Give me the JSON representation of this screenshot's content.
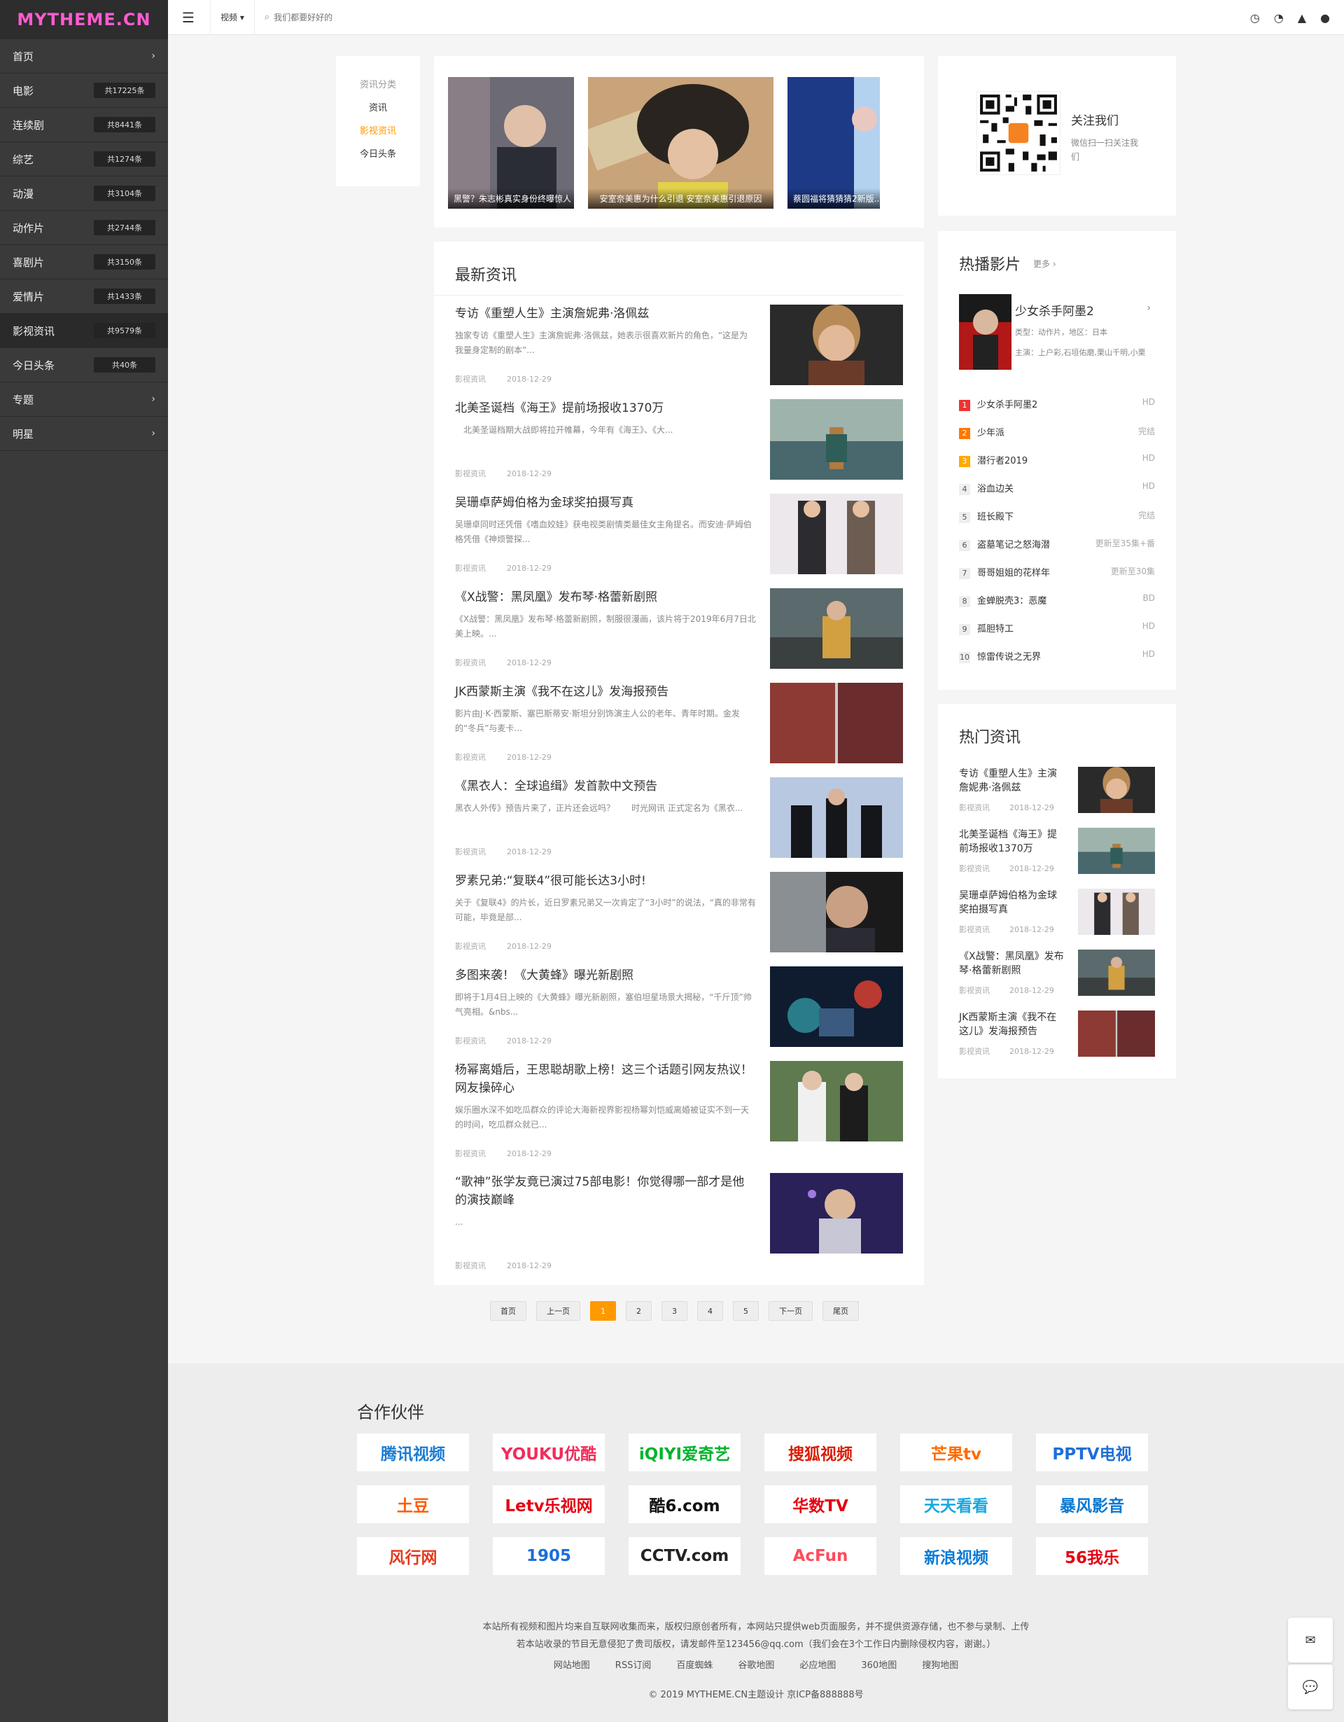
{
  "logo": "MYTHEME.CN",
  "nav": [
    {
      "label": "首页",
      "badge": "",
      "arrow": "›"
    },
    {
      "label": "电影",
      "badge": "共17225条",
      "arrow": ""
    },
    {
      "label": "连续剧",
      "badge": "共8441条",
      "arrow": ""
    },
    {
      "label": "综艺",
      "badge": "共1274条",
      "arrow": ""
    },
    {
      "label": "动漫",
      "badge": "共3104条",
      "arrow": ""
    },
    {
      "label": "动作片",
      "badge": "共2744条",
      "arrow": ""
    },
    {
      "label": "喜剧片",
      "badge": "共3150条",
      "arrow": ""
    },
    {
      "label": "爱情片",
      "badge": "共1433条",
      "arrow": ""
    },
    {
      "label": "影视资讯",
      "badge": "共9579条",
      "arrow": ""
    },
    {
      "label": "今日头条",
      "badge": "共40条",
      "arrow": ""
    },
    {
      "label": "专题",
      "badge": "",
      "arrow": "›"
    },
    {
      "label": "明星",
      "badge": "",
      "arrow": "›"
    }
  ],
  "topbar": {
    "select": "视频 ▾",
    "search_placeholder": "我们都要好好的",
    "icons": [
      "clock-icon",
      "rss-icon",
      "android-icon",
      "user-icon"
    ]
  },
  "category": {
    "title": "资讯分类",
    "items": [
      "资讯",
      "影视资讯",
      "今日头条"
    ],
    "active": 1
  },
  "slides": [
    {
      "caption": "黑警？朱志彬真实身份终曝惊人"
    },
    {
      "caption": "安室奈美惠为什么引退 安室奈美惠引退原因"
    },
    {
      "caption": "蔡圆福将猜猜猜2新版..."
    }
  ],
  "news": {
    "title": "最新资讯",
    "items": [
      {
        "title": "专访《重塑人生》主演詹妮弗·洛佩兹",
        "desc": "独家专访《重塑人生》主演詹妮弗·洛佩兹，她表示很喜欢新片的角色，“这是为我量身定制的剧本”...",
        "cat": "影视资讯",
        "date": "2018-12-29"
      },
      {
        "title": "北美圣诞档《海王》提前场报收1370万",
        "desc": "　北美圣诞档期大战即将拉开帷幕，今年有《海王》、《大...",
        "cat": "影视资讯",
        "date": "2018-12-29"
      },
      {
        "title": "吴珊卓萨姆伯格为金球奖拍摄写真",
        "desc": "吴珊卓同时还凭借《嗜血姣娃》获电视类剧情类最佳女主角提名。而安迪·萨姆伯格凭借《神烦警探...",
        "cat": "影视资讯",
        "date": "2018-12-29"
      },
      {
        "title": "《X战警：黑凤凰》发布琴·格蕾新剧照",
        "desc": "《X战警：黑凤凰》发布琴·格蕾新剧照，制服很漫画，该片将于2019年6月7日北美上映。...",
        "cat": "影视资讯",
        "date": "2018-12-29"
      },
      {
        "title": "JK西蒙斯主演《我不在这儿》发海报预告",
        "desc": "影片由J·K·西蒙斯、塞巴斯蒂安·斯坦分别饰演主人公的老年、青年时期。金发的“冬兵”与麦卡...",
        "cat": "影视资讯",
        "date": "2018-12-29"
      },
      {
        "title": "《黑衣人：全球追缉》发首款中文预告",
        "desc": "黑衣人外传》预告片来了，正片还会远吗？　　时光网讯 正式定名为《黑衣...",
        "cat": "影视资讯",
        "date": "2018-12-29"
      },
      {
        "title": "罗素兄弟:“复联4”很可能长达3小时!",
        "desc": "关于《复联4》的片长，近日罗素兄弟又一次肯定了“3小时”的说法，“真的非常有可能，毕竟是部...",
        "cat": "影视资讯",
        "date": "2018-12-29"
      },
      {
        "title": "多图来袭！《大黄蜂》曝光新剧照",
        "desc": "即将于1月4日上映的《大黄蜂》曝光新剧照，塞伯坦星场景大揭秘，“千斤顶”帅气亮相。&nbs...",
        "cat": "影视资讯",
        "date": "2018-12-29"
      },
      {
        "title": "杨幂离婚后，王思聪胡歌上榜！这三个话题引网友热议！网友操碎心",
        "desc": "娱乐圈水深不如吃瓜群众的评论大海新视界影视杨幂刘恺威离婚被证实不到一天的时间，吃瓜群众就已...",
        "cat": "影视资讯",
        "date": "2018-12-29"
      },
      {
        "title": "“歌神”张学友竟已演过75部电影！你觉得哪一部才是他的演技巅峰",
        "desc": "...",
        "cat": "影视资讯",
        "date": "2018-12-29"
      }
    ]
  },
  "pager": [
    "首页",
    "上一页",
    "1",
    "2",
    "3",
    "4",
    "5",
    "下一页",
    "尾页"
  ],
  "follow": {
    "title": "关注我们",
    "desc": "微信扫一扫关注我们"
  },
  "hot": {
    "title": "热播影片",
    "more": "更多 ›",
    "featured": {
      "name": "少女杀手阿墨2",
      "type": "类型：动作片，地区：日本",
      "cast": "主演：上户彩,石垣佑磨,栗山千明,小栗"
    },
    "list": [
      {
        "rank": "1",
        "name": "少女杀手阿墨2",
        "status": "HD"
      },
      {
        "rank": "2",
        "name": "少年派",
        "status": "完结"
      },
      {
        "rank": "3",
        "name": "潜行者2019",
        "status": "HD"
      },
      {
        "rank": "4",
        "name": "浴血边关",
        "status": "HD"
      },
      {
        "rank": "5",
        "name": "班长殿下",
        "status": "完结"
      },
      {
        "rank": "6",
        "name": "盗墓笔记之怒海潜",
        "status": "更新至35集+番"
      },
      {
        "rank": "7",
        "name": "哥哥姐姐的花样年",
        "status": "更新至30集"
      },
      {
        "rank": "8",
        "name": "金蝉脱壳3：恶魔",
        "status": "BD"
      },
      {
        "rank": "9",
        "name": "孤胆特工",
        "status": "HD"
      },
      {
        "rank": "10",
        "name": "惊雷传说之无界",
        "status": "HD"
      }
    ]
  },
  "hotnews": {
    "title": "热门资讯",
    "items": [
      {
        "title": "专访《重塑人生》主演詹妮弗·洛佩兹",
        "cat": "影视资讯",
        "date": "2018-12-29"
      },
      {
        "title": "北美圣诞档《海王》提前场报收1370万",
        "cat": "影视资讯",
        "date": "2018-12-29"
      },
      {
        "title": "吴珊卓萨姆伯格为金球奖拍摄写真",
        "cat": "影视资讯",
        "date": "2018-12-29"
      },
      {
        "title": "《X战警：黑凤凰》发布琴·格蕾新剧照",
        "cat": "影视资讯",
        "date": "2018-12-29"
      },
      {
        "title": "JK西蒙斯主演《我不在这儿》发海报预告",
        "cat": "影视资讯",
        "date": "2018-12-29"
      }
    ]
  },
  "partners": {
    "title": "合作伙伴",
    "logos": [
      {
        "name": "腾讯视频",
        "color": "#1a7cd3"
      },
      {
        "name": "YOUKU优酷",
        "color": "#f02d5b"
      },
      {
        "name": "iQIYI爱奇艺",
        "color": "#00b32c"
      },
      {
        "name": "搜狐视频",
        "color": "#d81e06"
      },
      {
        "name": "芒果tv",
        "color": "#ff6a00"
      },
      {
        "name": "PPTV电视",
        "color": "#1d6fd8"
      },
      {
        "name": "土豆",
        "color": "#ff5a00"
      },
      {
        "name": "Letv乐视网",
        "color": "#e60012"
      },
      {
        "name": "酷6.com",
        "color": "#111111"
      },
      {
        "name": "华数TV",
        "color": "#e60012"
      },
      {
        "name": "天天看看",
        "color": "#15a8e0"
      },
      {
        "name": "暴风影音",
        "color": "#0a78d1"
      },
      {
        "name": "风行网",
        "color": "#e53a1e"
      },
      {
        "name": "1905",
        "color": "#1b6fd8"
      },
      {
        "name": "CCTV.com",
        "color": "#222222"
      },
      {
        "name": "AcFun",
        "color": "#fd4c5d"
      },
      {
        "name": "新浪视频",
        "color": "#0a7bd8"
      },
      {
        "name": "56我乐",
        "color": "#e60012"
      }
    ]
  },
  "footer": {
    "line1": "本站所有视频和图片均来自互联网收集而来，版权归原创者所有，本网站只提供web页面服务，并不提供资源存储，也不参与录制、上传",
    "line2": "若本站收录的节目无意侵犯了贵司版权，请发邮件至123456@qq.com（我们会在3个工作日内删除侵权内容，谢谢。）",
    "links": [
      "网站地图",
      "RSS订阅",
      "百度蜘蛛",
      "谷歌地图",
      "必应地图",
      "360地图",
      "搜狗地图"
    ],
    "copyright": "© 2019 MYTHEME.CN主题设计 京ICP备888888号"
  },
  "side_buttons": [
    "wechat-icon",
    "chat-icon"
  ]
}
